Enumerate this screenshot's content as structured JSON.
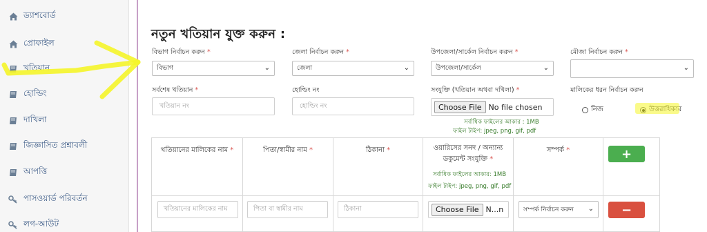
{
  "sidebar": {
    "items": [
      {
        "label": "ড্যাশবোর্ড",
        "icon": "home-icon"
      },
      {
        "label": "প্রোফাইল",
        "icon": "home-icon"
      },
      {
        "label": "খতিয়ান",
        "icon": "book-icon"
      },
      {
        "label": "হোল্ডিং",
        "icon": "book-icon"
      },
      {
        "label": "দাখিলা",
        "icon": "book-icon"
      },
      {
        "label": "জিজ্ঞাসিত প্রশ্নাবলী",
        "icon": "book-icon"
      },
      {
        "label": "আপত্তি",
        "icon": "book-icon"
      },
      {
        "label": "পাসওয়ার্ড পরিবর্তন",
        "icon": "key-icon"
      },
      {
        "label": "লগ-আউট",
        "icon": "key-icon"
      }
    ]
  },
  "main": {
    "title": "নতুন খতিয়ান যুক্ত করুন :",
    "row1": {
      "division_label": "বিভাগ নির্বাচন করুন",
      "division_value": "বিভাগ",
      "district_label": "জেলা নির্বাচন করুন",
      "district_value": "জেলা",
      "upazila_label": "উপজেলা/সার্কেল নির্বাচন করুন",
      "upazila_value": "উপজেলা/সার্কেল",
      "mouza_label": "মৌজা নির্বাচন করুন",
      "mouza_value": ""
    },
    "row2": {
      "khatian_label": "সর্বশেষ খতিয়ান",
      "khatian_placeholder": "খতিয়ান নং",
      "holding_label": "হোল্ডিং নং",
      "holding_placeholder": "হোল্ডিং নং",
      "attach_label": "সংযুক্তি (খতিয়ান অথবা দখিলা)",
      "file_button": "Choose File",
      "file_status": "No file chosen",
      "hint_size": "সর্বাধিক ফাইলের আকার : 1MB",
      "hint_type": "ফাইল টাইপ: jpeg, png, gif, pdf",
      "owner_type_label": "মালিকের ধরন নির্বাচন করুন",
      "option_own": "নিজ",
      "option_inherit": "উত্তরাধিকার"
    },
    "table": {
      "headers": {
        "owner_name": "খতিয়ানের মালিকের নাম",
        "father_name": "পিতা/স্বামীর নাম",
        "address": "ঠিকানা",
        "doc_line1": "ওয়ারিসের সনদ / অন্যান্য",
        "doc_line2": "ডকুমেন্ট সংযুক্তি",
        "doc_hint_size": "সর্বাধিক ফাইলের আকার: 1MB",
        "doc_hint_type": "ফাইল টাইপ: jpeg, png, gif, pdf",
        "relation": "সম্পর্ক"
      },
      "row": {
        "owner_placeholder": "খতিয়ানের মালিকের নাম",
        "father_placeholder": "পিতা বা স্বামীর নাম",
        "address_placeholder": "ঠিকানা",
        "file_button": "Choose File",
        "file_status": "N...n",
        "relation_value": "সম্পর্ক নির্বাচন করুন"
      },
      "add_symbol": "+",
      "remove_symbol": "−"
    }
  },
  "colors": {
    "highlighter": "#f5f52a",
    "add_button": "#4bae4f",
    "remove_button": "#d9503f",
    "sidebar_text": "#3b5a86",
    "hint_text": "#3a7d2d",
    "required": "#d9534f"
  }
}
